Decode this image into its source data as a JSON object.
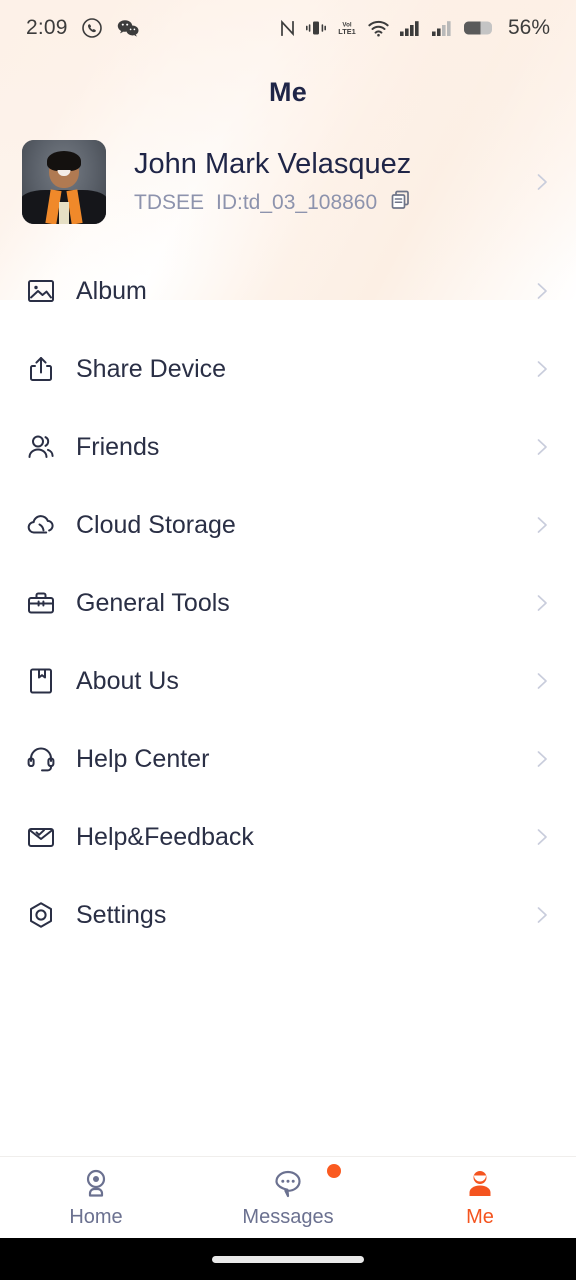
{
  "status_bar": {
    "time": "2:09",
    "left_icons": [
      "viber-icon",
      "wechat-icon"
    ],
    "right_icons": [
      "nfc-icon",
      "vibrate-icon",
      "volte-icon",
      "wifi-icon",
      "signal-icon",
      "signal-2-icon"
    ],
    "battery_percent": "56%"
  },
  "header": {
    "title": "Me"
  },
  "profile": {
    "name": "John Mark Velasquez",
    "brand": "TDSEE",
    "id": "ID:td_03_108860",
    "copy_icon": "copy-icon",
    "chevron": "chevron-right-icon"
  },
  "menu": {
    "items": [
      {
        "label": "Album",
        "icon": "image-icon"
      },
      {
        "label": "Share Device",
        "icon": "share-icon"
      },
      {
        "label": "Friends",
        "icon": "people-icon"
      },
      {
        "label": "Cloud Storage",
        "icon": "cloud-icon"
      },
      {
        "label": "General Tools",
        "icon": "toolbox-icon"
      },
      {
        "label": "About Us",
        "icon": "bookmark-icon"
      },
      {
        "label": "Help Center",
        "icon": "headset-icon"
      },
      {
        "label": "Help&Feedback",
        "icon": "envelope-check-icon"
      },
      {
        "label": "Settings",
        "icon": "settings-gear-icon"
      }
    ]
  },
  "tabbar": {
    "tabs": [
      {
        "label": "Home",
        "icon": "camera-icon",
        "active": false,
        "badge": false
      },
      {
        "label": "Messages",
        "icon": "chat-icon",
        "active": false,
        "badge": true
      },
      {
        "label": "Me",
        "icon": "person-icon",
        "active": true,
        "badge": false
      }
    ]
  },
  "colors": {
    "accent": "#f4541f",
    "badge": "#fa5a20",
    "title": "#1f2547",
    "label": "#2a2f45",
    "muted": "#8d93ad",
    "chevron": "#c9cddc"
  }
}
